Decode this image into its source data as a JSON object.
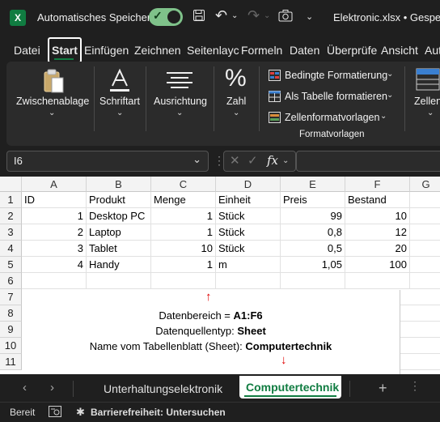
{
  "titlebar": {
    "logo": "X",
    "autosave_label": "Automatisches Speichern",
    "filename": "Elektronic.xlsx • Gespeich",
    "icons": [
      "save-icon",
      "undo-icon",
      "redo-icon",
      "camera-icon",
      "more-icon"
    ]
  },
  "menu": [
    "Datei",
    "Start",
    "Einfügen",
    "Zeichnen",
    "Seitenlayc",
    "Formeln",
    "Daten",
    "Überprüfe",
    "Ansicht",
    "Aut"
  ],
  "ribbon": {
    "clipboard": "Zwischenablage",
    "font": "Schriftart",
    "alignment": "Ausrichtung",
    "number": "Zahl",
    "number_symbol": "%",
    "cond_format": "Bedingte Formatierung",
    "as_table": "Als Tabelle formatieren",
    "cell_styles": "Zellenformatvorlagen",
    "group_styles": "Formatvorlagen",
    "cells": "Zellen"
  },
  "formula_bar": {
    "name_box": "I6",
    "fx": "fx",
    "formula": ""
  },
  "columns": [
    "A",
    "B",
    "C",
    "D",
    "E",
    "F",
    "G"
  ],
  "rows": [
    "1",
    "2",
    "3",
    "4",
    "5",
    "6",
    "7",
    "8",
    "9",
    "10",
    "11"
  ],
  "table": {
    "header": [
      "ID",
      "Produkt",
      "Menge",
      "Einheit",
      "Preis",
      "Bestand"
    ],
    "data": [
      [
        "1",
        "Desktop PC",
        "1",
        "Stück",
        "99",
        "10"
      ],
      [
        "2",
        "Laptop",
        "1",
        "Stück",
        "0,8",
        "12"
      ],
      [
        "3",
        "Tablet",
        "10",
        "Stück",
        "0,5",
        "20"
      ],
      [
        "4",
        "Handy",
        "1",
        "m",
        "1,05",
        "100"
      ]
    ]
  },
  "annotation": {
    "line1_label": "Datenbereich = ",
    "line1_value": "A1:F6",
    "line2_label": "Datenquellentyp: ",
    "line2_value": "Sheet",
    "line3_label": "Name vom Tabellenblatt (Sheet): ",
    "line3_value": "Computertechnik",
    "arrow_up": "↑",
    "arrow_down": "↓"
  },
  "sheets": {
    "tabs": [
      "Unterhaltungselektronik",
      "Computertechnik"
    ],
    "active": "Computertechnik",
    "add": "+"
  },
  "status": {
    "ready": "Bereit",
    "accessibility": "Barrierefreiheit: Untersuchen"
  },
  "colors": {
    "excel_green": "#107c41",
    "toggle_on": "#7fc28a",
    "annotation_arrow": "#e00000",
    "active_tab_underline": "#107c41"
  }
}
